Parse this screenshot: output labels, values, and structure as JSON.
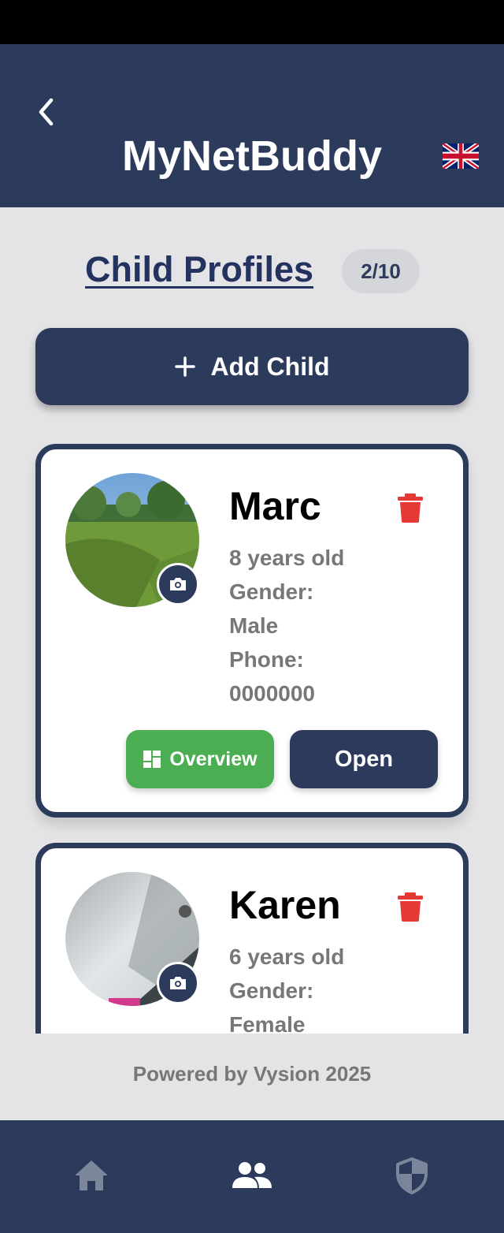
{
  "app": {
    "title": "MyNetBuddy"
  },
  "header": {
    "back_icon": "chevron-left-icon",
    "language_icon": "uk-flag-icon"
  },
  "profiles": {
    "title": "Child Profiles",
    "count": "2/10",
    "add_button_label": "Add Child",
    "children": [
      {
        "name": "Marc",
        "age": "8 years old",
        "gender_label": "Gender:",
        "gender": "Male",
        "phone_label": "Phone:",
        "phone": "0000000",
        "overview_label": "Overview",
        "open_label": "Open"
      },
      {
        "name": "Karen",
        "age": "6 years old",
        "gender_label": "Gender:",
        "gender": "Female"
      }
    ]
  },
  "footer": {
    "text": "Powered by Vysion 2025"
  },
  "nav": {
    "items": [
      "home-icon",
      "people-icon",
      "shield-icon"
    ],
    "active": "people-icon"
  },
  "colors": {
    "primary": "#2c3a5c",
    "accent_green": "#4cae52",
    "danger": "#e53935",
    "background": "#e4e4e6",
    "muted_text": "#777777"
  }
}
